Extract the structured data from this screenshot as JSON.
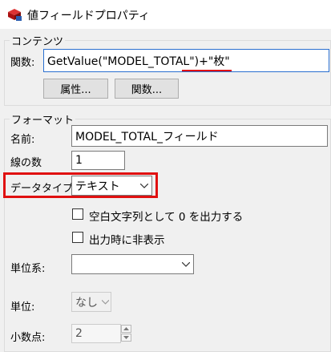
{
  "window": {
    "title": "値フィールドプロパティ"
  },
  "contents": {
    "group_label": "コンテンツ",
    "expression_label": "関数:",
    "expression_value": "GetValue(\"MODEL_TOTAL\")+\"枚\"",
    "attribute_button": "属性...",
    "function_button": "関数..."
  },
  "format": {
    "group_label": "フォーマット",
    "name_label": "名前:",
    "name_value": "MODEL_TOTAL_フィールド",
    "lines_label": "線の数",
    "lines_value": "1",
    "datatype_label": "データタイプ:",
    "datatype_value": "テキスト",
    "blank_checkbox_label": "空白文字列として 0 を出力する",
    "blank_checkbox_checked": false,
    "hide_checkbox_label": "出力時に非表示",
    "hide_checkbox_checked": false,
    "unit_system_label": "単位系:",
    "unit_system_value": "",
    "unit_label": "単位:",
    "unit_value": "なし",
    "decimal_label": "小数点:",
    "decimal_value": "2"
  },
  "colors": {
    "highlight_red": "#e01010",
    "accent_blue": "#2a6fd0"
  }
}
